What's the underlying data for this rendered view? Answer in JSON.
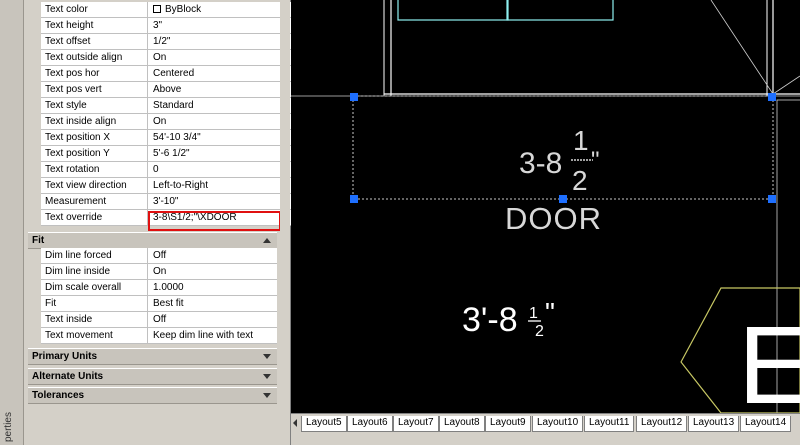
{
  "palette": {
    "strip_label": "perties",
    "text_rows": [
      {
        "name": "Text color",
        "value": "ByBlock",
        "checkbox": true
      },
      {
        "name": "Text height",
        "value": "3\""
      },
      {
        "name": "Text offset",
        "value": "1/2\""
      },
      {
        "name": "Text outside align",
        "value": "On"
      },
      {
        "name": "Text pos hor",
        "value": "Centered"
      },
      {
        "name": "Text pos vert",
        "value": "Above"
      },
      {
        "name": "Text style",
        "value": "Standard"
      },
      {
        "name": "Text inside align",
        "value": "On"
      },
      {
        "name": "Text position X",
        "value": "54'-10 3/4\""
      },
      {
        "name": "Text position Y",
        "value": "5'-6 1/2\""
      },
      {
        "name": "Text rotation",
        "value": "0"
      },
      {
        "name": "Text view direction",
        "value": "Left-to-Right"
      },
      {
        "name": "Measurement",
        "value": "3'-10\""
      },
      {
        "name": "Text override",
        "value": "3-8\\S1/2;\"\\XDOOR"
      }
    ],
    "fit_section": {
      "title": "Fit",
      "rows": [
        {
          "name": "Dim line forced",
          "value": "Off"
        },
        {
          "name": "Dim line inside",
          "value": "On"
        },
        {
          "name": "Dim scale overall",
          "value": "1.0000"
        },
        {
          "name": "Fit",
          "value": "Best fit"
        },
        {
          "name": "Text inside",
          "value": "Off"
        },
        {
          "name": "Text movement",
          "value": "Keep dim line with text"
        }
      ]
    },
    "collapsed_sections": [
      "Primary Units",
      "Alternate Units",
      "Tolerances"
    ]
  },
  "canvas": {
    "dim_text_main": "3-8",
    "dim_text_num": "1",
    "dim_text_den": "2",
    "dim_text_inch": "\"",
    "dim_text_door": "DOOR",
    "label_main": "3'-8",
    "label_num": "1",
    "label_den": "2",
    "label_inch": "\"",
    "big_letter": "E"
  },
  "tabs": [
    "Layout5",
    "Layout6",
    "Layout7",
    "Layout8",
    "Layout9",
    "Layout10",
    "Layout11",
    "Layout12",
    "Layout13",
    "Layout14"
  ],
  "colors": {
    "highlight": "#e01010",
    "grip": "#1e6fff",
    "tag_outline": "#c8c864",
    "wall_cyan": "#8ef0f0"
  }
}
